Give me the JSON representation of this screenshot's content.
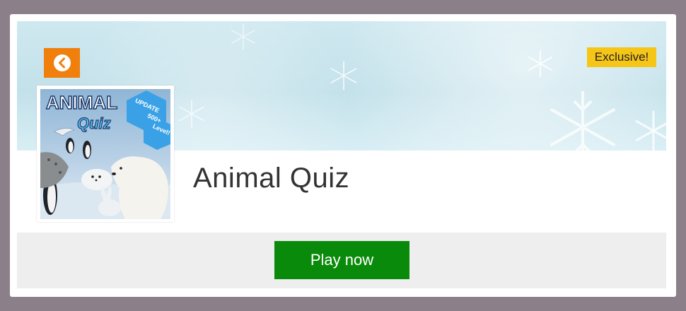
{
  "game": {
    "title": "Animal Quiz",
    "badge": "Exclusive!",
    "play_label": "Play now",
    "thumbnail": {
      "title_line1": "ANIMAL",
      "title_line2": "Quiz",
      "update_text_1": "UPDATE",
      "update_text_2": "500+",
      "update_text_3": "Level!"
    }
  },
  "colors": {
    "page_bg": "#8b8089",
    "back_button": "#f07f0b",
    "badge": "#f5c518",
    "play_button": "#0a8a0a",
    "footer_bg": "#eeeeee"
  },
  "icons": {
    "back": "chevron-left-circle-icon",
    "decoration": "snowflake-icon"
  }
}
